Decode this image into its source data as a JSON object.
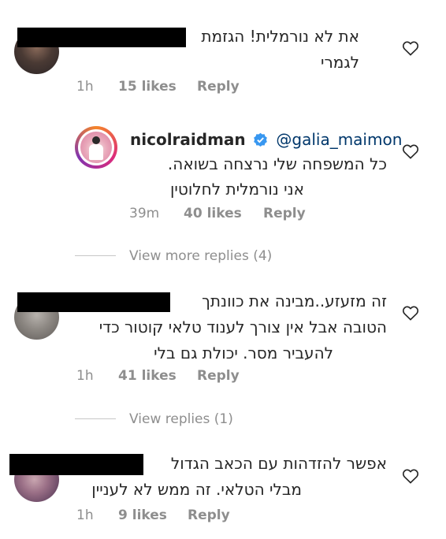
{
  "comments": [
    {
      "lines": [
        "את לא נורמלית! הגזמת",
        "לגמרי"
      ],
      "time": "1h",
      "likes": "15 likes",
      "reply_label": "Reply"
    },
    {
      "username": "nicolraidman",
      "mention": "@galia_maimon",
      "lines": [
        "כל המשפחה שלי נרצחה בשואה.",
        "אני נורמלית לחלוטין"
      ],
      "time": "39m",
      "likes": "40 likes",
      "reply_label": "Reply"
    },
    {
      "lines": [
        "זה מזעזע..מבינה את כוונתך",
        "הטובה אבל אין צורך לענוד טלאי קוטור כדי",
        "להעביר מסר. יכולת גם בלי"
      ],
      "time": "1h",
      "likes": "41 likes",
      "reply_label": "Reply"
    },
    {
      "lines": [
        "אפשר להזדהות עם הכאב הגדול",
        "מבלי הטלאי. זה ממש לא לעניין"
      ],
      "time": "1h",
      "likes": "9 likes",
      "reply_label": "Reply"
    }
  ],
  "view_more_replies": "View more replies (4)",
  "view_replies": "View replies (1)",
  "icons": {
    "like": "heart-outline-icon",
    "verified": "verified-badge-icon"
  },
  "colors": {
    "text": "#262626",
    "meta": "#8e8e8e",
    "mention": "#00376b",
    "verified": "#3897f0"
  }
}
